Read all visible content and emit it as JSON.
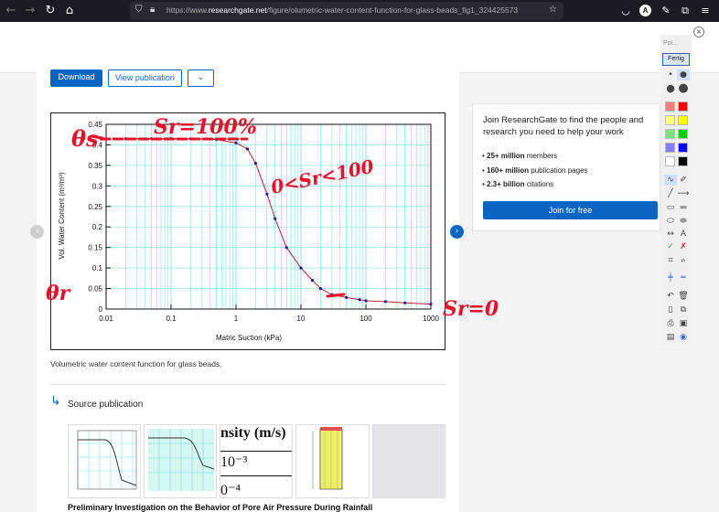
{
  "browser": {
    "url_prefix": "https://www.",
    "url_domain": "researchgate.net",
    "url_rest": "/figure/olumetric-water-content-function-for-glass-beads_fig1_324425573",
    "avatar_letter": "A"
  },
  "actions": {
    "download_label": "Download",
    "view_label": "View publication"
  },
  "figure": {
    "caption": "Volumetric water content function for glass beads."
  },
  "chart_data": {
    "type": "line",
    "title": "",
    "xlabel": "Matric Suction (kPa)",
    "ylabel": "Vol. Water Content (m³/m³)",
    "xscale": "log",
    "xlim": [
      0.01,
      1000
    ],
    "ylim": [
      0,
      0.45
    ],
    "grid": true,
    "x_ticks": [
      "0.01",
      "0.1",
      "1",
      "10",
      "100",
      "1000"
    ],
    "y_ticks": [
      "0",
      "0.05",
      "0.1",
      "0.15",
      "0.2",
      "0.25",
      "0.3",
      "0.35",
      "0.4",
      "0.45"
    ],
    "series": [
      {
        "color": "#1a1aa0",
        "points": [
          [
            0.02,
            0.415
          ],
          [
            0.05,
            0.415
          ],
          [
            0.1,
            0.415
          ],
          [
            0.2,
            0.415
          ],
          [
            0.5,
            0.413
          ],
          [
            1,
            0.405
          ],
          [
            1.5,
            0.39
          ],
          [
            2,
            0.355
          ],
          [
            3,
            0.28
          ],
          [
            4,
            0.22
          ],
          [
            6,
            0.15
          ],
          [
            10,
            0.1
          ],
          [
            15,
            0.07
          ],
          [
            20,
            0.05
          ],
          [
            30,
            0.035
          ],
          [
            50,
            0.028
          ],
          [
            80,
            0.023
          ],
          [
            100,
            0.02
          ],
          [
            200,
            0.018
          ],
          [
            400,
            0.015
          ],
          [
            1000,
            0.012
          ]
        ]
      }
    ]
  },
  "annotations": {
    "theta_s": "θs",
    "sr_100": "Sr=100%",
    "sr_range": "0<Sr<100",
    "theta_r": "θr",
    "sr_0": "Sr=0"
  },
  "source": {
    "label": "Source publication",
    "thumb3_line1": "nsity (m/s)",
    "thumb3_line2": "10⁻³",
    "thumb3_line3": "0⁻⁴",
    "pub_title": "Preliminary Investigation on the Behavior of Pore Air Pressure During Rainfall"
  },
  "join": {
    "title": "Join ResearchGate to find the people and research you need to help your work",
    "b1_strong": "25+ million",
    "b1_rest": " members",
    "b2_strong": "160+ million",
    "b2_rest": " publication pages",
    "b3_strong": "2.3+ billion",
    "b3_rest": " citations",
    "button": "Join for free"
  },
  "palette": {
    "poi_label": "Poi...",
    "done_label": "Fertig",
    "colors": [
      "#f08080",
      "#ff0000",
      "#ffff80",
      "#ffff00",
      "#80e080",
      "#00cc00",
      "#8080ff",
      "#0000ff",
      "#ffffff",
      "#000000"
    ]
  }
}
